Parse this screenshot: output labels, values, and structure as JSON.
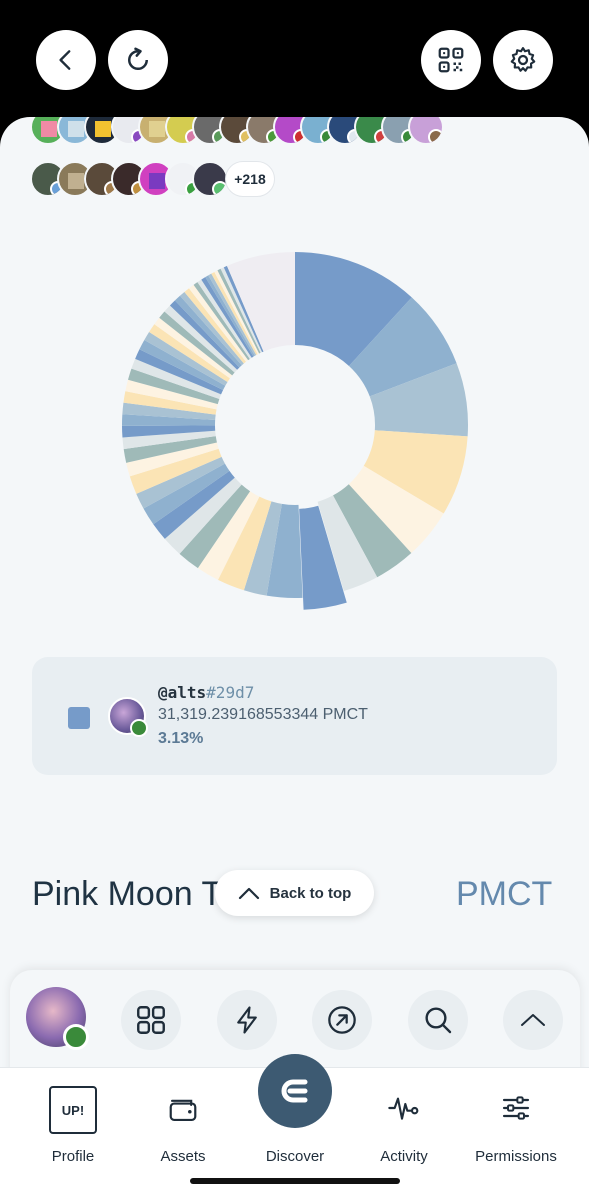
{
  "header": {
    "back_icon": "chevron-left-icon",
    "refresh_icon": "refresh-icon",
    "qr_icon": "qr-code-icon",
    "settings_icon": "gear-icon"
  },
  "holders": {
    "more_count": "+218"
  },
  "chart_data": {
    "type": "pie",
    "donut": true,
    "values": [
      11.0,
      6.9,
      6.4,
      7.0,
      4.4,
      3.6,
      3.1,
      3.6,
      3.1,
      2.0,
      2.4,
      2.0,
      2.0,
      1.8,
      1.6,
      1.6,
      1.4,
      1.6,
      1.2,
      1.2,
      1.0,
      1.0,
      1.0,
      1.0,
      1.0,
      1.0,
      1.0,
      0.9,
      0.9,
      0.9,
      0.8,
      0.8,
      0.7,
      0.7,
      0.7,
      0.6,
      0.6,
      0.5,
      0.5,
      0.5,
      0.4,
      0.4,
      0.4,
      0.3,
      0.3,
      0.3,
      0.3,
      0.3,
      0.3,
      0.3,
      6.0
    ],
    "colors": [
      "#769bc9",
      "#8fb1cf",
      "#a9c2d3",
      "#fbe4b5",
      "#fdf3e2",
      "#9fbab8",
      "#dfe6e8",
      "#769bc9",
      "#8fb1cf",
      "#a9c2d3",
      "#fbe4b5",
      "#fdf3e2",
      "#9fbab8",
      "#dfe6e8",
      "#769bc9",
      "#8fb1cf",
      "#a9c2d3",
      "#fbe4b5",
      "#fdf3e2",
      "#9fbab8",
      "#dfe6e8",
      "#769bc9",
      "#8fb1cf",
      "#a9c2d3",
      "#fbe4b5",
      "#fdf3e2",
      "#9fbab8",
      "#dfe6e8",
      "#769bc9",
      "#8fb1cf",
      "#a9c2d3",
      "#fbe4b5",
      "#fdf3e2",
      "#9fbab8",
      "#dfe6e8",
      "#769bc9",
      "#8fb1cf",
      "#a9c2d3",
      "#fbe4b5",
      "#fdf3e2",
      "#9fbab8",
      "#dfe6e8",
      "#769bc9",
      "#8fb1cf",
      "#a9c2d3",
      "#fbe4b5",
      "#fdf3e2",
      "#9fbab8",
      "#dfe6e8",
      "#769bc9",
      "#efedf2"
    ],
    "highlighted_index": 7
  },
  "selected_holder": {
    "name": "@alts",
    "hash": "#29d7",
    "amount": "31,319.239168553344 PMCT",
    "percent": "3.13%",
    "color": "#769bc9"
  },
  "token": {
    "name": "Pink Moon Token",
    "symbol": "PMCT"
  },
  "back_to_top": "Back to top",
  "toolbar": {
    "apps_icon": "grid-icon",
    "bolt_icon": "lightning-icon",
    "open_icon": "arrow-up-right-circle-icon",
    "search_icon": "search-icon",
    "expand_icon": "chevron-up-icon"
  },
  "tabs": {
    "profile": "Profile",
    "profile_badge": "UP!",
    "assets": "Assets",
    "discover": "Discover",
    "activity": "Activity",
    "permissions": "Permissions"
  }
}
